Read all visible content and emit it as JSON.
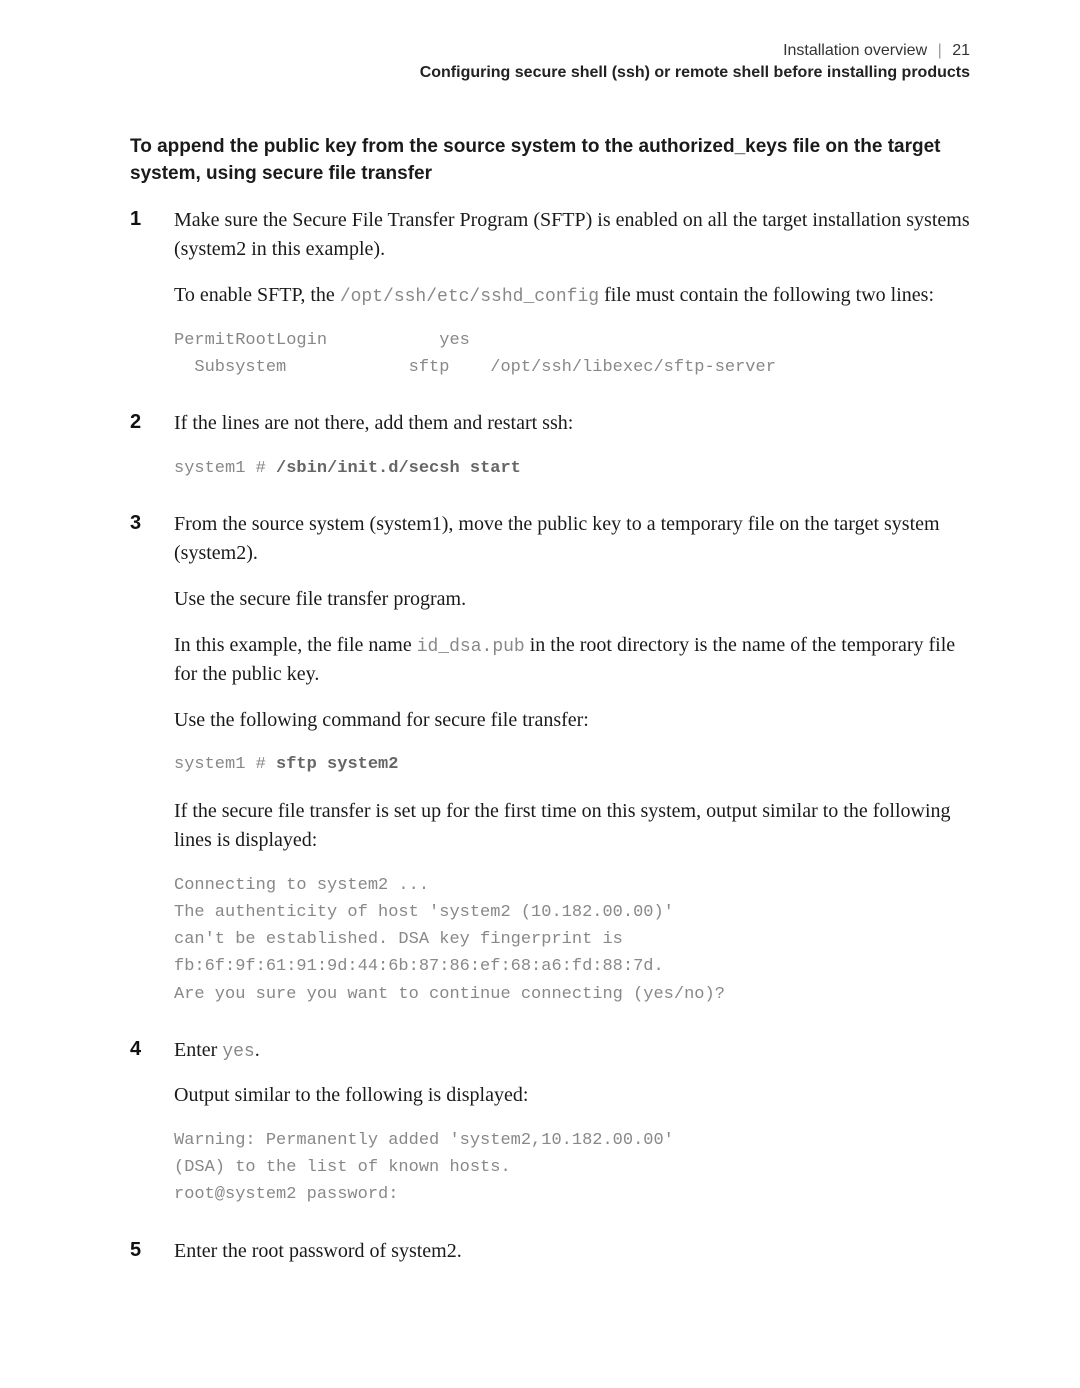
{
  "header": {
    "section": "Installation overview",
    "divider": "|",
    "page_num": "21",
    "subsection": "Configuring secure shell (ssh) or remote shell before installing products"
  },
  "procedure_title": "To append the public key from the source system to the authorized_keys file on the target system, using secure file transfer",
  "steps": [
    {
      "num": "1",
      "blocks": [
        {
          "type": "para",
          "segments": [
            {
              "text": "Make sure the Secure File Transfer Program (SFTP) is enabled on all the target installation systems (system2 in this example)."
            }
          ]
        },
        {
          "type": "para",
          "segments": [
            {
              "text": "To enable SFTP, the "
            },
            {
              "code": "/opt/ssh/etc/sshd_config"
            },
            {
              "text": " file must contain the following two lines:"
            }
          ]
        },
        {
          "type": "codeblock",
          "lines": [
            {
              "segments": [
                {
                  "text": "PermitRootLogin           yes"
                }
              ]
            },
            {
              "segments": [
                {
                  "text": "  Subsystem            sftp    /opt/ssh/libexec/sftp-server"
                }
              ]
            }
          ]
        }
      ]
    },
    {
      "num": "2",
      "blocks": [
        {
          "type": "para",
          "segments": [
            {
              "text": "If the lines are not there, add them and restart ssh:"
            }
          ]
        },
        {
          "type": "codeblock",
          "lines": [
            {
              "segments": [
                {
                  "text": "system1 # "
                },
                {
                  "strong": "/sbin/init.d/secsh start"
                }
              ]
            }
          ]
        }
      ]
    },
    {
      "num": "3",
      "blocks": [
        {
          "type": "para",
          "segments": [
            {
              "text": "From the source system (system1), move the public key to a temporary file on the target system (system2)."
            }
          ]
        },
        {
          "type": "para",
          "segments": [
            {
              "text": "Use the secure file transfer program."
            }
          ]
        },
        {
          "type": "para",
          "segments": [
            {
              "text": "In this example, the file name "
            },
            {
              "code": "id_dsa.pub"
            },
            {
              "text": " in the root directory is the name of the temporary file for the public key."
            }
          ]
        },
        {
          "type": "para",
          "segments": [
            {
              "text": "Use the following command for secure file transfer:"
            }
          ]
        },
        {
          "type": "codeblock",
          "lines": [
            {
              "segments": [
                {
                  "text": "system1 # "
                },
                {
                  "strong": "sftp system2"
                }
              ]
            }
          ]
        },
        {
          "type": "para",
          "segments": [
            {
              "text": "If the secure file transfer is set up for the first time on this system, output similar to the following lines is displayed:"
            }
          ]
        },
        {
          "type": "codeblock",
          "lines": [
            {
              "segments": [
                {
                  "text": "Connecting to system2 ..."
                }
              ]
            },
            {
              "segments": [
                {
                  "text": "The authenticity of host 'system2 (10.182.00.00)'"
                }
              ]
            },
            {
              "segments": [
                {
                  "text": "can't be established. DSA key fingerprint is"
                }
              ]
            },
            {
              "segments": [
                {
                  "text": "fb:6f:9f:61:91:9d:44:6b:87:86:ef:68:a6:fd:88:7d."
                }
              ]
            },
            {
              "segments": [
                {
                  "text": "Are you sure you want to continue connecting (yes/no)?"
                }
              ]
            }
          ]
        }
      ]
    },
    {
      "num": "4",
      "blocks": [
        {
          "type": "para",
          "segments": [
            {
              "text": "Enter "
            },
            {
              "code": "yes"
            },
            {
              "text": "."
            }
          ]
        },
        {
          "type": "para",
          "segments": [
            {
              "text": "Output similar to the following is displayed:"
            }
          ]
        },
        {
          "type": "codeblock",
          "lines": [
            {
              "segments": [
                {
                  "text": "Warning: Permanently added 'system2,10.182.00.00'"
                }
              ]
            },
            {
              "segments": [
                {
                  "text": "(DSA) to the list of known hosts."
                }
              ]
            },
            {
              "segments": [
                {
                  "text": "root@system2 password:"
                }
              ]
            }
          ]
        }
      ]
    },
    {
      "num": "5",
      "blocks": [
        {
          "type": "para",
          "segments": [
            {
              "text": "Enter the root password of system2."
            }
          ]
        }
      ]
    }
  ]
}
